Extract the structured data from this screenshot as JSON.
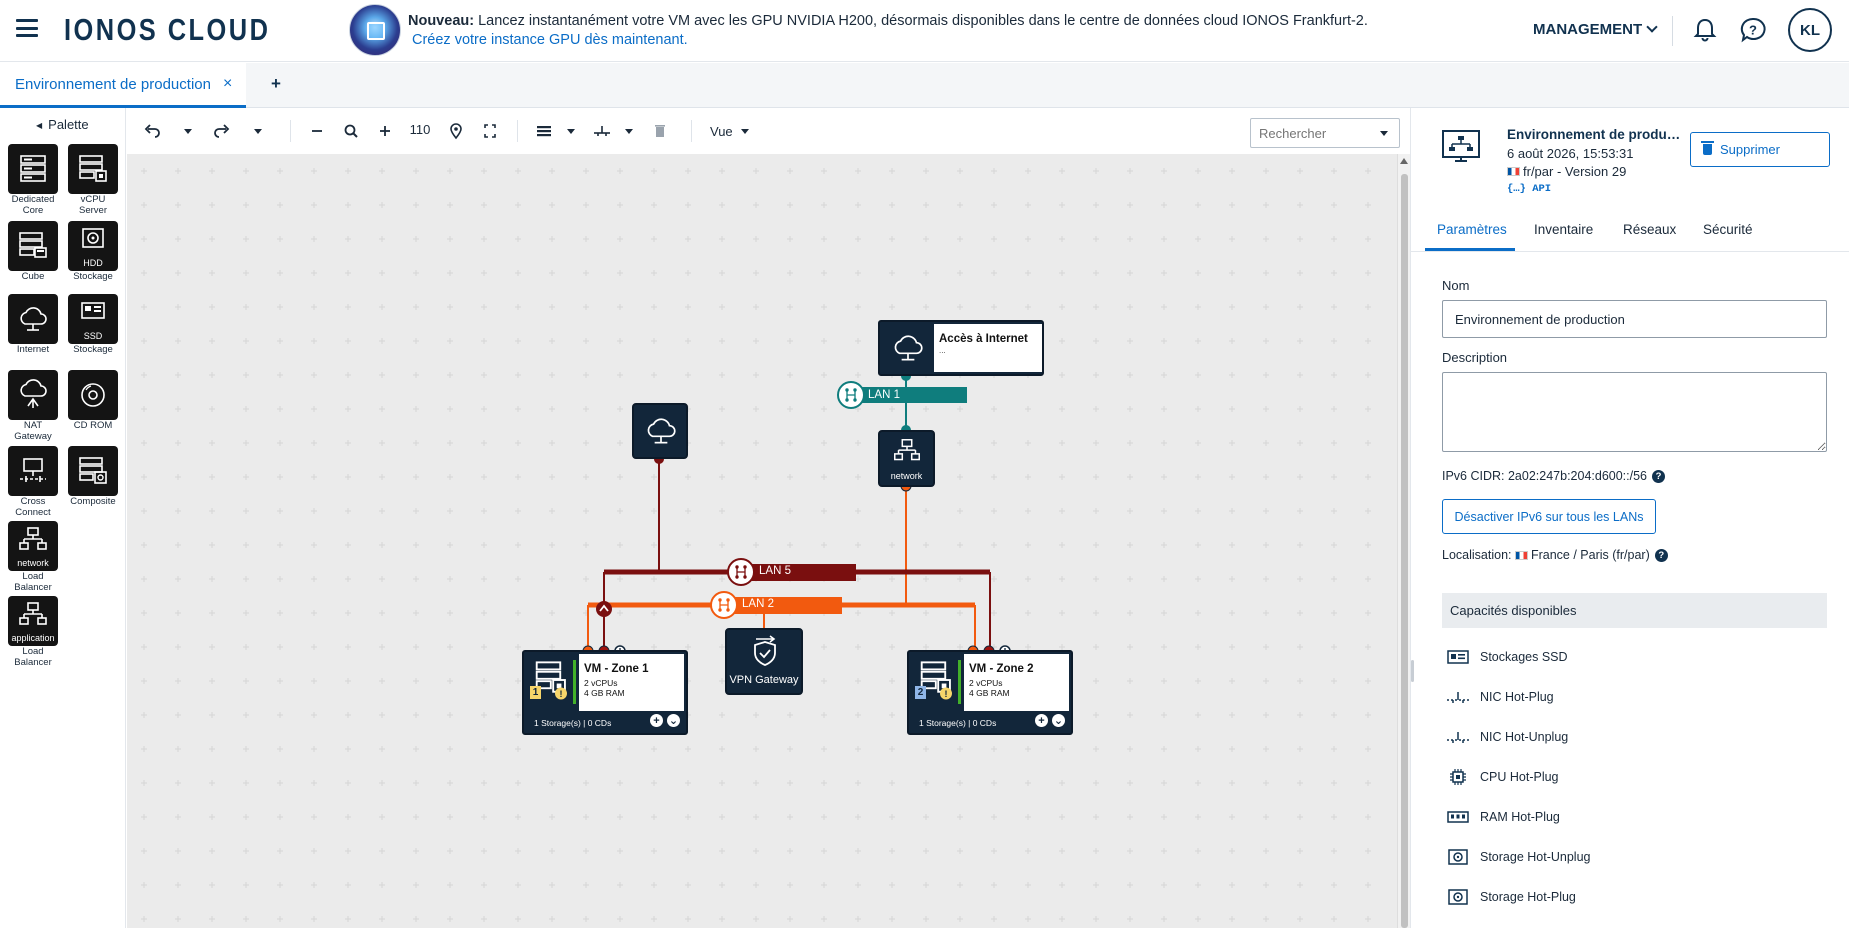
{
  "header": {
    "logo": "IONOS CLOUD",
    "announcement_bold": "Nouveau:",
    "announcement_text": " Lancez instantanément votre VM avec les GPU NVIDIA H200, désormais disponibles dans le centre de données cloud IONOS Frankfurt-2.",
    "announcement_link": "Créez votre instance GPU dès maintenant.",
    "management_label": "MANAGEMENT",
    "avatar_initials": "KL"
  },
  "tabs": {
    "active_label": "Environnement de production",
    "close": "×",
    "add": "+"
  },
  "palette": {
    "title": "Palette",
    "items": [
      {
        "label": "Dedicated Core",
        "icon": "server-stack-icon"
      },
      {
        "label": "vCPU Server",
        "icon": "vcpu-server-icon"
      },
      {
        "label": "Cube",
        "icon": "cube-icon"
      },
      {
        "label": "HDD Stockage",
        "inner": "HDD",
        "caption": "Stockage",
        "icon": "hdd-icon"
      },
      {
        "label": "Internet",
        "icon": "cloud-icon"
      },
      {
        "label": "SSD Stockage",
        "inner": "SSD",
        "caption": "Stockage",
        "icon": "ssd-icon"
      },
      {
        "label": "NAT Gateway",
        "icon": "nat-gateway-icon"
      },
      {
        "label": "CD ROM",
        "icon": "cdrom-icon"
      },
      {
        "label": "Cross Connect",
        "icon": "cross-connect-icon"
      },
      {
        "label": "Composite",
        "icon": "composite-icon"
      },
      {
        "label": "Load Balancer",
        "inner": "network",
        "caption": "Load Balancer",
        "icon": "network-lb-icon"
      },
      {
        "label": "Load Balancer",
        "inner": "application",
        "caption": "Load Balancer",
        "icon": "application-lb-icon"
      }
    ]
  },
  "toolbar": {
    "zoom": "110",
    "view_label": "Vue",
    "search_placeholder": "Rechercher"
  },
  "diagram": {
    "internet_access": {
      "title": "Accès à Internet",
      "sub": "..."
    },
    "lan1": "LAN 1",
    "lan5": "LAN 5",
    "lan2": "LAN 2",
    "network_node": "network",
    "vpn": "VPN Gateway",
    "vm1": {
      "title": "VM - Zone 1",
      "cpu": "2 vCPUs",
      "ram": "4 GB RAM",
      "footer": "1 Storage(s) | 0 CDs",
      "zone": "1"
    },
    "vm2": {
      "title": "VM - Zone 2",
      "cpu": "2 vCPUs",
      "ram": "4 GB RAM",
      "footer": "1 Storage(s) | 0 CDs",
      "zone": "2"
    },
    "colors": {
      "lan1": "#0f7d7d",
      "lan5": "#7a0f0f",
      "lan2": "#f25a0f",
      "node": "#12263a"
    }
  },
  "panel": {
    "title": "Environnement de producti...",
    "date": "6 août 2026, 15:53:31",
    "location": "fr/par - Version 29",
    "api": "{…} API",
    "delete": "Supprimer",
    "tabs": [
      "Paramètres",
      "Inventaire",
      "Réseaux",
      "Sécurité"
    ],
    "name_label": "Nom",
    "name_value": "Environnement de production",
    "description_label": "Description",
    "ipv6": "IPv6 CIDR: 2a02:247b:204:d600::/56",
    "ipv6_button": "Désactiver IPv6 sur tous les LANs",
    "localisation_label": "Localisation:",
    "localisation_value": "France / Paris (fr/par)",
    "capabilities_title": "Capacités disponibles",
    "capabilities": [
      {
        "label": "Stockages SSD",
        "icon": "ssd-icon"
      },
      {
        "label": "NIC Hot-Plug",
        "icon": "nic-icon"
      },
      {
        "label": "NIC Hot-Unplug",
        "icon": "nic-icon"
      },
      {
        "label": "CPU Hot-Plug",
        "icon": "cpu-icon"
      },
      {
        "label": "RAM Hot-Plug",
        "icon": "ram-icon"
      },
      {
        "label": "Storage Hot-Unplug",
        "icon": "storage-icon"
      },
      {
        "label": "Storage Hot-Plug",
        "icon": "storage-icon"
      }
    ]
  }
}
